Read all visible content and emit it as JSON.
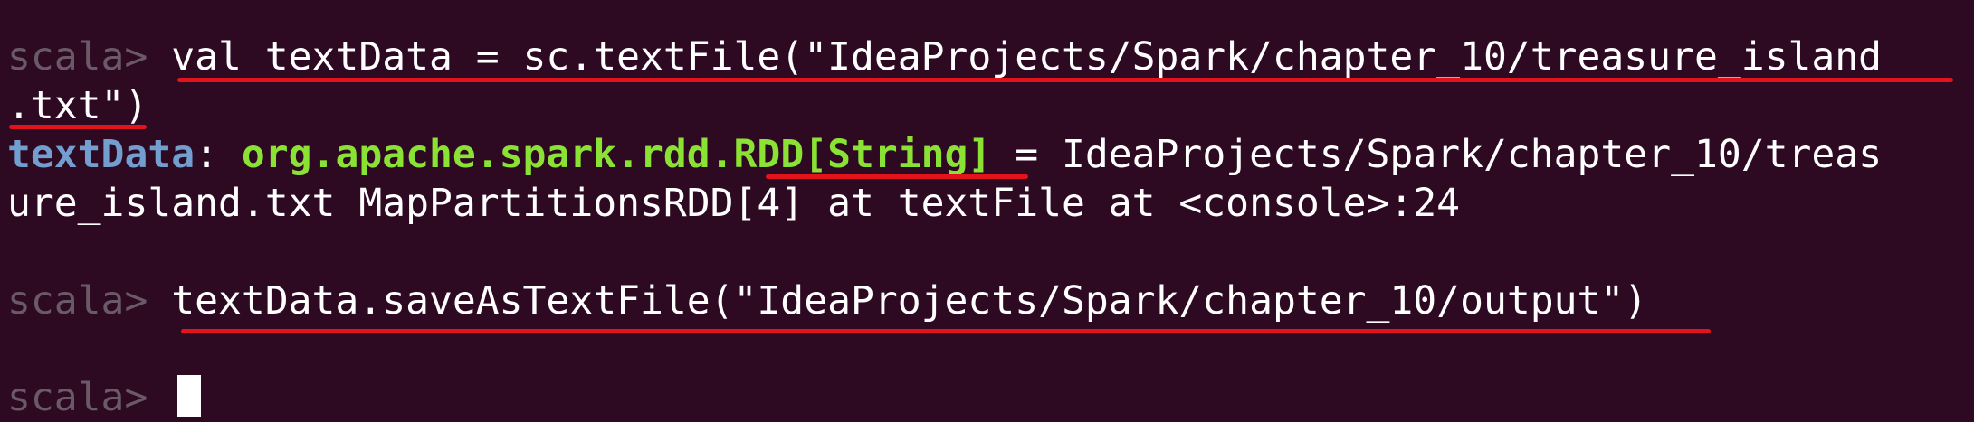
{
  "terminal": {
    "prompt": "scala> ",
    "line1": {
      "command": "val textData = sc.textFile(\"IdeaProjects/Spark/chapter_10/treasure_island"
    },
    "line2": {
      "command": ".txt\")"
    },
    "line3": {
      "identifier": "textData",
      "colon": ": ",
      "type_prefix": "org.apache.spark.rdd.",
      "type_rdd": "RDD[String]",
      "rest": " = IdeaProjects/Spark/chapter_10/treas"
    },
    "line4": {
      "text": "ure_island.txt MapPartitionsRDD[4] at textFile at <console>:24"
    },
    "line5": {
      "command": "textData.saveAsTextFile(\"IdeaProjects/Spark/chapter_10/output\")"
    },
    "colors": {
      "background": "#2d0922",
      "prompt": "#6a5a67",
      "identifier": "#729fcf",
      "type": "#8ae234",
      "text": "#ffffff",
      "annotation_underline": "#e3131b"
    }
  }
}
